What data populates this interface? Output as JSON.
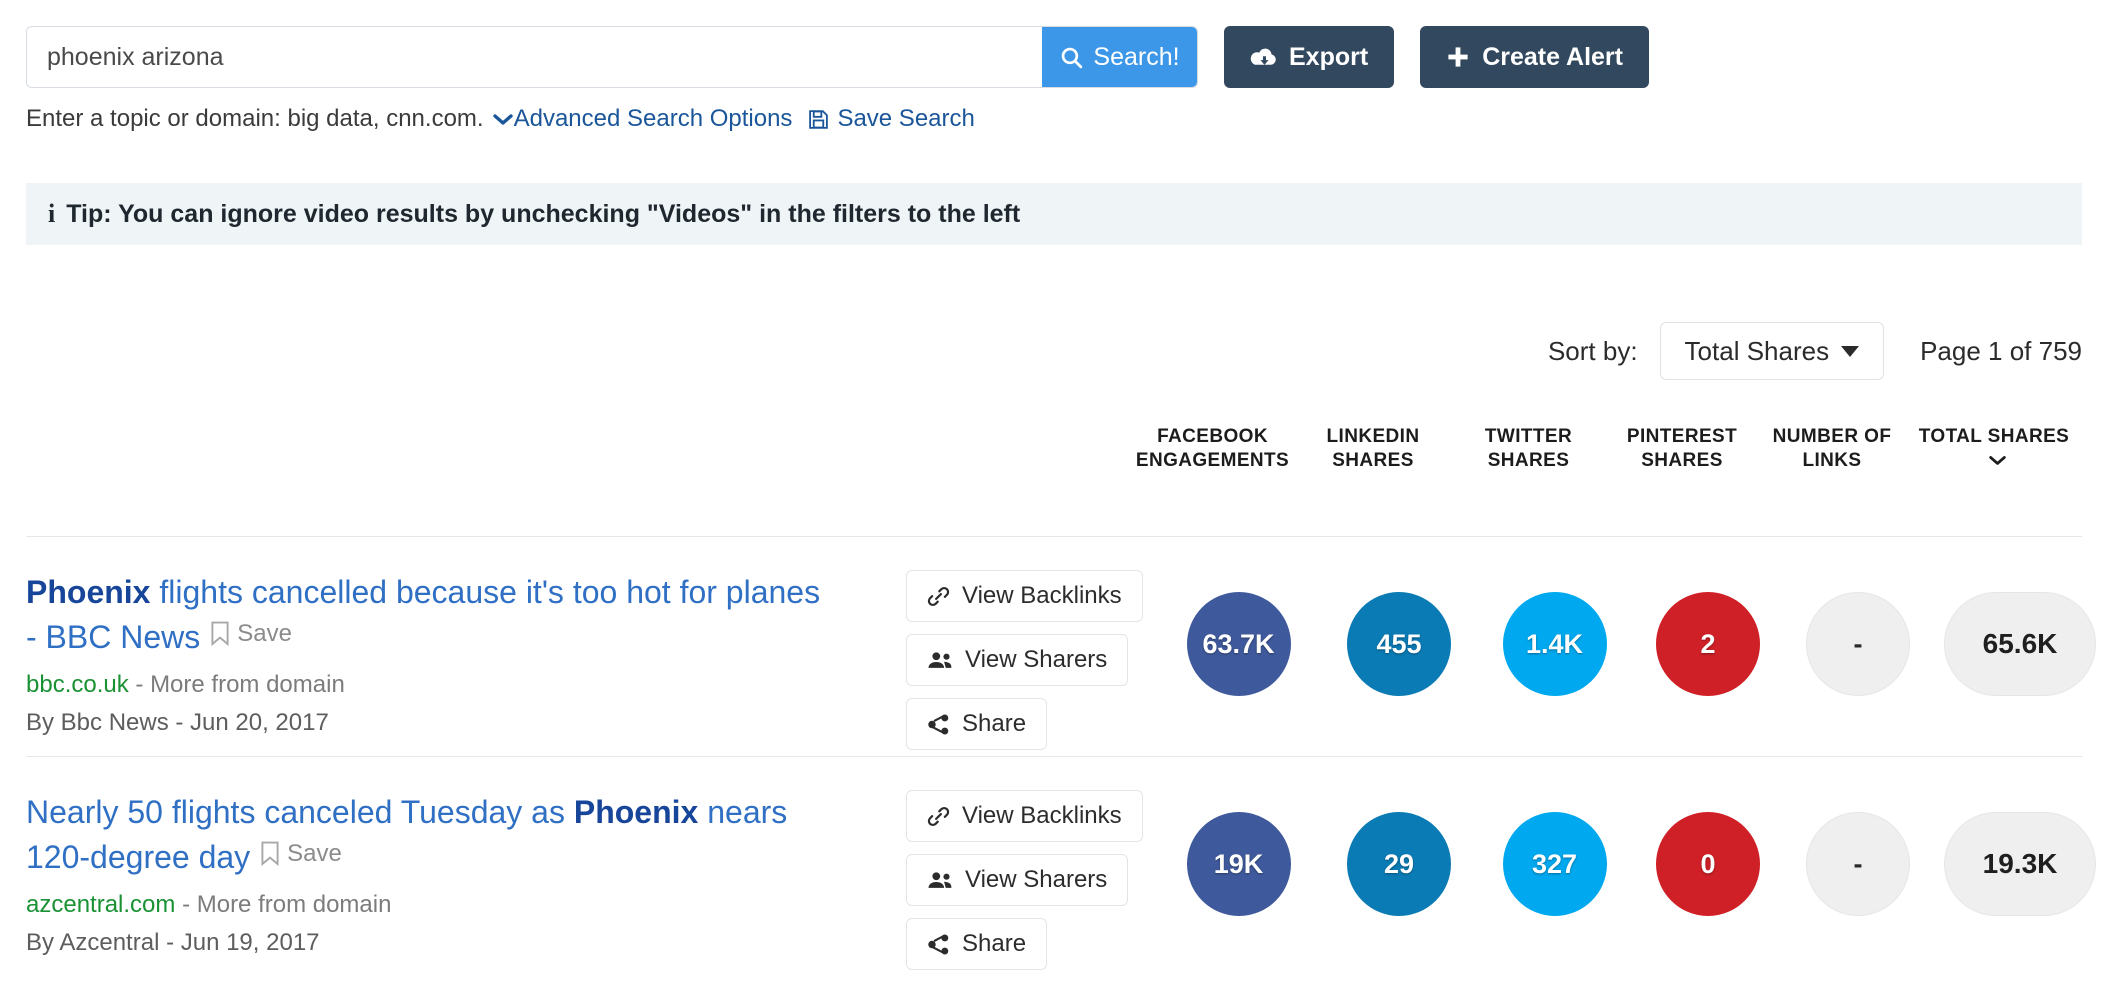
{
  "search": {
    "value": "phoenix arizona",
    "placeholder": "Enter a topic or domain",
    "search_button": "Search!",
    "export_button": "Export",
    "create_alert_button": "Create Alert"
  },
  "hint": {
    "text": "Enter a topic or domain: big data, cnn.com.",
    "advanced_link": "Advanced Search Options",
    "save_search_link": "Save Search"
  },
  "tip": {
    "text": "Tip: You can ignore video results by unchecking \"Videos\" in the filters to the left"
  },
  "toolbar": {
    "sort_label": "Sort by:",
    "sort_value": "Total Shares",
    "page_info": "Page 1 of 759"
  },
  "columns": [
    {
      "line1": "FACEBOOK",
      "line2": "ENGAGEMENTS"
    },
    {
      "line1": "LINKEDIN",
      "line2": "SHARES"
    },
    {
      "line1": "TWITTER",
      "line2": "SHARES"
    },
    {
      "line1": "PINTEREST",
      "line2": "SHARES"
    },
    {
      "line1": "NUMBER OF",
      "line2": "LINKS"
    },
    {
      "line1": "TOTAL SHARES",
      "line2": ""
    }
  ],
  "actions": {
    "backlinks": "View Backlinks",
    "sharers": "View Sharers",
    "share": "Share",
    "save": "Save"
  },
  "results": [
    {
      "title_pre": "",
      "title_bold": "Phoenix",
      "title_post": " flights cancelled because it's too hot for planes - BBC News",
      "domain": "bbc.co.uk",
      "more_from_domain": "- More from domain",
      "byline": "By Bbc News - Jun 20, 2017",
      "metrics": {
        "facebook": "63.7K",
        "linkedin": "455",
        "twitter": "1.4K",
        "pinterest": "2",
        "links": "-",
        "total": "65.6K"
      }
    },
    {
      "title_pre": "Nearly 50 flights canceled Tuesday as ",
      "title_bold": "Phoenix",
      "title_post": " nears 120-degree day",
      "domain": "azcentral.com",
      "more_from_domain": "- More from domain",
      "byline": "By Azcentral - Jun 19, 2017",
      "metrics": {
        "facebook": "19K",
        "linkedin": "29",
        "twitter": "327",
        "pinterest": "0",
        "links": "-",
        "total": "19.3K"
      }
    }
  ],
  "colors": {
    "facebook": "#3f5a9c",
    "linkedin": "#0b7bb5",
    "twitter": "#00a8ef",
    "pinterest": "#cf2027",
    "neutral": "#efefef",
    "accent_blue": "#3c97e8",
    "dark_navy": "#32485e",
    "link_blue": "#2f6fc4",
    "domain_green": "#1a9234"
  }
}
